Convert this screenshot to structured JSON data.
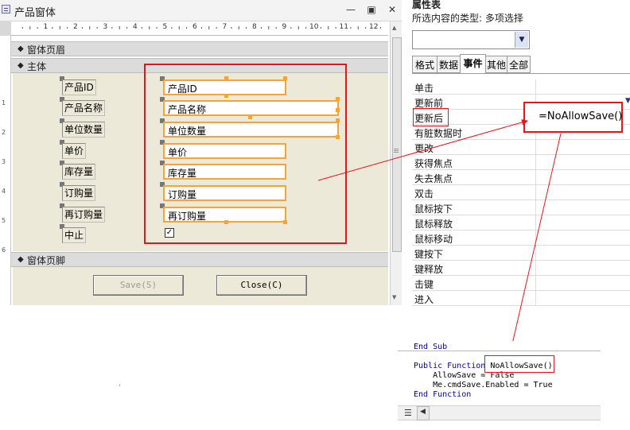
{
  "form_window": {
    "title": "产品窗体",
    "controls_minimize": "—",
    "controls_restore": "▣",
    "controls_close": "✕",
    "ruler_numbers": [
      "1",
      "2",
      "3",
      "4",
      "5",
      "6",
      "7",
      "8",
      "9",
      "10",
      "11",
      "12"
    ],
    "vertical_ruler_numbers": [
      "1",
      "2",
      "3",
      "4",
      "5",
      "6"
    ],
    "sections": {
      "header": "窗体页眉",
      "detail": "主体",
      "footer": "窗体页脚"
    },
    "fields": [
      {
        "label": "产品ID",
        "textbox": "产品ID"
      },
      {
        "label": "产品名称",
        "textbox": "产品名称"
      },
      {
        "label": "单位数量",
        "textbox": "单位数量"
      },
      {
        "label": "单价",
        "textbox": "单价"
      },
      {
        "label": "库存量",
        "textbox": "库存量"
      },
      {
        "label": "订购量",
        "textbox": "订购量"
      },
      {
        "label": "再订购量",
        "textbox": "再订购量"
      },
      {
        "label": "中止",
        "checkbox": "✓"
      }
    ],
    "buttons": {
      "save": "Save(S)",
      "close": "Close(C)"
    }
  },
  "property_sheet": {
    "title": "属性表",
    "selection_type": "所选内容的类型: 多项选择",
    "combo_value": "",
    "tabs": [
      "格式",
      "数据",
      "事件",
      "其他",
      "全部"
    ],
    "active_tab": "事件",
    "events": [
      "单击",
      "更新前",
      "更新后",
      "有脏数据时",
      "更改",
      "获得焦点",
      "失去焦点",
      "双击",
      "鼠标按下",
      "鼠标释放",
      "鼠标移动",
      "键按下",
      "键释放",
      "击键",
      "进入"
    ],
    "highlighted_event": "更新后",
    "highlighted_value": "=NoAllowSave()"
  },
  "code_snippet": {
    "line1": "End Sub",
    "line2_kw": "Public Function",
    "line2_name": "NoAllowSave()",
    "line3": "    AllowSave = False",
    "line4": "    Me.cmdSave.Enabled = True",
    "line5": "End Function"
  },
  "colors": {
    "annotation_red": "#e8141c",
    "selection_orange": "#f6a43a",
    "form_background": "#ece9d8",
    "code_keyword": "#0000a0"
  }
}
